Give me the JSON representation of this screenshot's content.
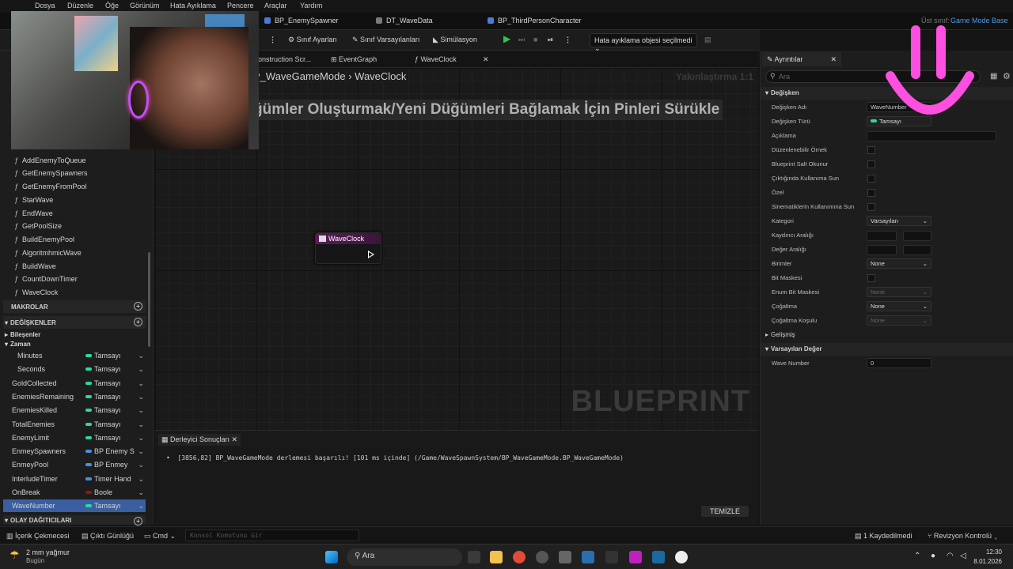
{
  "menubar": {
    "items": [
      "Dosya",
      "Düzenle",
      "Öğe",
      "Görünüm",
      "Hata Ayıklama",
      "Pencere",
      "Araçlar",
      "Yardım"
    ]
  },
  "tabs": {
    "items": [
      "BP_EnemySpawner",
      "DT_WaveData",
      "BP_ThirdPersonCharacter"
    ],
    "parent_class_label": "Üst sınıf:",
    "parent_class_value": "Game Mode Base"
  },
  "toolbar": {
    "class_settings": "Sınıf Ayarları",
    "class_defaults": "Sınıf Varsayılanları",
    "simulation": "Simülasyon",
    "debug_object": "Hata ayıklama objesi seçilmedi"
  },
  "graph_tabs": {
    "items": [
      "onstruction Scr...",
      "EventGraph",
      "WaveClock"
    ]
  },
  "graph": {
    "breadcrumb_root": "P_WaveGameMode",
    "breadcrumb_current": "WaveClock",
    "zoom": "Yakınlaştırma 1:1",
    "hint": "ğümler Oluşturmak/Yeni Düğümleri Bağlamak İçin Pinleri Sürükle",
    "watermark": "BLUEPRINT",
    "node_title": "WaveClock"
  },
  "compiler": {
    "tab_label": "Derleyici Sonuçları",
    "message": "[3856,82] BP_WaveGameMode derlemesi başarılı! [101 ms içinde] (/Game/WaveSpawnSystem/BP_WaveGameMode.BP_WaveGameMode)",
    "clear_label": "TEMİZLE"
  },
  "left_panel": {
    "functions": [
      "AddEnemyToQueue",
      "GetEnemySpawners",
      "GetEnemyFromPool",
      "StarWave",
      "EndWave",
      "GetPoolSize",
      "BuildEnemyPool",
      "AlgoritmhmicWave",
      "BuildWave",
      "CountDownTimer",
      "WaveClock"
    ],
    "macros_label": "MAKROLAR",
    "variables_label": "DEĞİŞKENLER",
    "group_components": "Bileşenler",
    "group_time": "Zaman",
    "variables": [
      {
        "name": "Minutes",
        "type": "Tamsayı",
        "color": "#2fd6a4"
      },
      {
        "name": "Seconds",
        "type": "Tamsayı",
        "color": "#2fd6a4"
      },
      {
        "name": "GoldCollected",
        "type": "Tamsayı",
        "color": "#2fd6a4"
      },
      {
        "name": "EnemiesRemaining",
        "type": "Tamsayı",
        "color": "#2fd6a4"
      },
      {
        "name": "EnemiesKilled",
        "type": "Tamsayı",
        "color": "#2fd6a4"
      },
      {
        "name": "TotalEnemies",
        "type": "Tamsayı",
        "color": "#2fd6a4"
      },
      {
        "name": "EnemyLimit",
        "type": "Tamsayı",
        "color": "#2fd6a4"
      },
      {
        "name": "EnmeySpawners",
        "type": "BP Enemy S",
        "color": "#4a90e2"
      },
      {
        "name": "EnmeyPool",
        "type": "BP Enmey",
        "color": "#4a90e2"
      },
      {
        "name": "InterludeTimer",
        "type": "Timer Hand",
        "color": "#4a90e2"
      },
      {
        "name": "OnBreak",
        "type": "Boole",
        "color": "#a01010"
      },
      {
        "name": "WaveNumber",
        "type": "Tamsayı",
        "color": "#2fd6a4"
      }
    ],
    "event_dispatchers_label": "OLAY DAĞITICILARI"
  },
  "details": {
    "tab_label": "Ayrıntılar",
    "search_placeholder": "Ara",
    "cat_variable": "Değişken",
    "cat_default": "Varsayılan Değer",
    "props": {
      "var_name": "Değişken Adı",
      "var_name_value": "WaveNumber",
      "var_type": "Değişken Türü",
      "var_type_value": "Tamsayı",
      "description": "Açıklama",
      "editable": "Düzenlenebilir Örnek",
      "readonly": "Blueprint Salt Okunur",
      "expose_spawn": "Çıktığında Kullanıma Sun",
      "private": "Özel",
      "expose_cinematics": "Sinematiklerin Kullanımına Sun",
      "category": "Kategori",
      "category_value": "Varsayılan",
      "slider_range": "Kaydırıcı Aralığı",
      "value_range": "Değer Aralığı",
      "units": "Birimler",
      "units_value": "None",
      "bitmask": "Bit Maskesi",
      "enum_bitmask": "Enum Bit Maskesi",
      "enum_bitmask_value": "None",
      "replication": "Çoğaltma",
      "replication_value": "None",
      "rep_condition": "Çoğaltma Koşulu",
      "rep_condition_value": "None",
      "advanced": "Gelişmiş",
      "wave_number": "Wave Number",
      "wave_number_value": "0"
    }
  },
  "bottom_bar": {
    "content_drawer": "İçerik Çekmecesi",
    "output_log": "Çıktı Günlüğü",
    "cmd": "Cmd",
    "console_placeholder": "Konsol Komutunu Gir",
    "saved": "1 Kaydedilmedi",
    "revision": "Revizyon Kontrolü"
  },
  "taskbar": {
    "weather_temp": "2 mm yağmur",
    "weather_day": "Bugün",
    "search": "Ara",
    "time": "12:30",
    "date": "8.01.2026"
  }
}
